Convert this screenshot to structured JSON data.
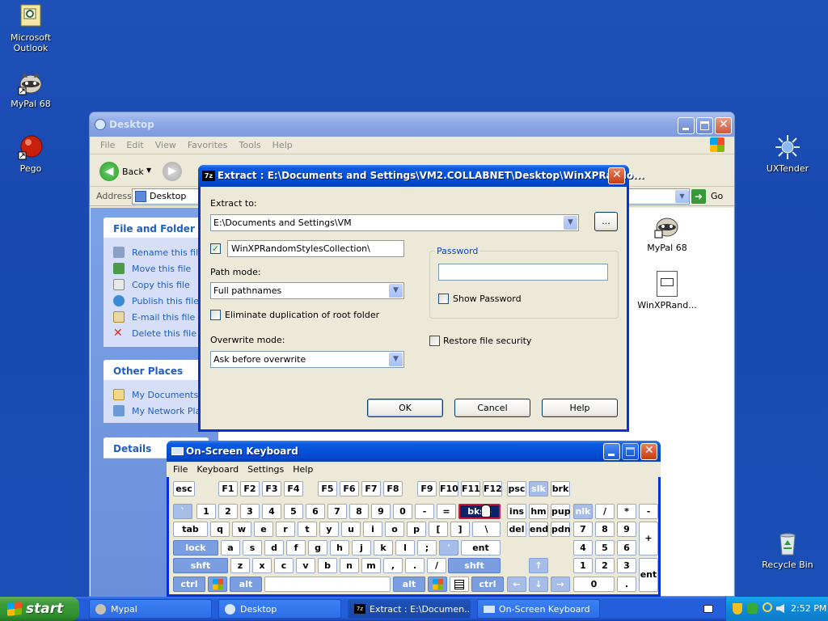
{
  "desktop_icons": [
    {
      "label_line1": "Microsoft",
      "label_line2": "Outlook",
      "icon": "outlook-icon"
    },
    {
      "label_line1": "MyPal 68",
      "label_line2": "",
      "icon": "mypal-raccoon-icon"
    },
    {
      "label_line1": "Pego",
      "label_line2": "",
      "icon": "pego-icon"
    },
    {
      "label_line1": "UXTender",
      "label_line2": "",
      "icon": "uxtender-icon"
    },
    {
      "label_line1": "Recycle Bin",
      "label_line2": "",
      "icon": "recycle-bin-icon"
    }
  ],
  "explorer": {
    "title": "Desktop",
    "menu": [
      "File",
      "Edit",
      "View",
      "Favorites",
      "Tools",
      "Help"
    ],
    "back_label": "Back",
    "address_label": "Address",
    "address_value": "Desktop",
    "go_label": "Go",
    "file_tasks_title": "File and Folder Tasks",
    "file_tasks": [
      "Rename this file",
      "Move this file",
      "Copy this file",
      "Publish this file to the Web",
      "E-mail this file",
      "Delete this file"
    ],
    "other_places_title": "Other Places",
    "other_places": [
      "My Documents",
      "My Network Places"
    ],
    "details_title": "Details",
    "files": [
      {
        "label": "MyPal 68"
      },
      {
        "label": "WinXPRand..."
      }
    ]
  },
  "extract": {
    "title": "Extract : E:\\Documents and Settings\\VM2.COLLABNET\\Desktop\\WinXPRando...",
    "extract_to_label": "Extract to:",
    "extract_to_value": "E:\\Documents and Settings\\VM",
    "browse_label": "...",
    "subfolder_value": "WinXPRandomStylesCollection\\",
    "subfolder_checked": true,
    "path_mode_label": "Path mode:",
    "path_mode_value": "Full pathnames",
    "eliminate_label": "Eliminate duplication of root folder",
    "overwrite_label": "Overwrite mode:",
    "overwrite_value": "Ask before overwrite",
    "password_group_label": "Password",
    "password_value": "",
    "show_password_label": "Show Password",
    "restore_security_label": "Restore file security",
    "ok_label": "OK",
    "cancel_label": "Cancel",
    "help_label": "Help"
  },
  "osk": {
    "title": "On-Screen Keyboard",
    "menu": [
      "File",
      "Keyboard",
      "Settings",
      "Help"
    ]
  },
  "taskbar": {
    "start_label": "start",
    "tasks": [
      "Mypal",
      "Desktop",
      "Extract : E:\\Documen...",
      "On-Screen Keyboard"
    ],
    "clock": "2:52 PM"
  },
  "colors": {
    "accent": "#0a5ae0",
    "desktop": "#1e51b8",
    "highlight_key_border": "#d4154b"
  }
}
